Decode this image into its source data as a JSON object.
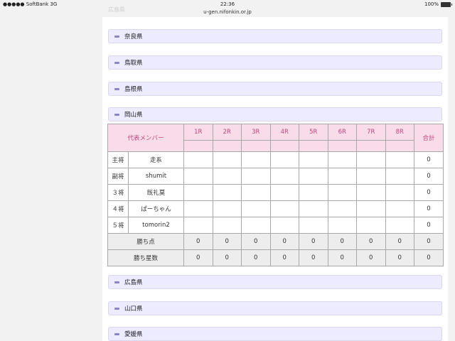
{
  "status_bar": {
    "carrier": "●●●●● SoftBank  3G",
    "time": "22:36",
    "battery": "100%"
  },
  "url": "u-gen.nifonkin.or.jp",
  "prefectures_above": [
    {
      "label": "広島県",
      "faded": true
    },
    {
      "label": "奈良県"
    },
    {
      "label": "鳥取県"
    },
    {
      "label": "島根県"
    },
    {
      "label": "岡山県"
    }
  ],
  "prefectures_below": [
    {
      "label": "広島県"
    },
    {
      "label": "山口県"
    },
    {
      "label": "愛媛県"
    }
  ],
  "score_table": {
    "member_header": "代表メンバー",
    "rounds": [
      "1R",
      "2R",
      "3R",
      "4R",
      "5R",
      "6R",
      "7R",
      "8R"
    ],
    "total_header": "合計",
    "members": [
      {
        "role": "主将",
        "name": "走系",
        "total": "0"
      },
      {
        "role": "副将",
        "name": "shumit",
        "total": "0"
      },
      {
        "role": "３将",
        "name": "既礼莫",
        "total": "0"
      },
      {
        "role": "４将",
        "name": "ぱーちゃん",
        "total": "0"
      },
      {
        "role": "５将",
        "name": "tomorin2",
        "total": "0"
      }
    ],
    "totals": [
      {
        "label": "勝ち点",
        "values": [
          "0",
          "0",
          "0",
          "0",
          "0",
          "0",
          "0",
          "0"
        ],
        "total": "0"
      },
      {
        "label": "勝ち星数",
        "values": [
          "0",
          "0",
          "0",
          "0",
          "0",
          "0",
          "0",
          "0"
        ],
        "total": "0"
      }
    ]
  }
}
